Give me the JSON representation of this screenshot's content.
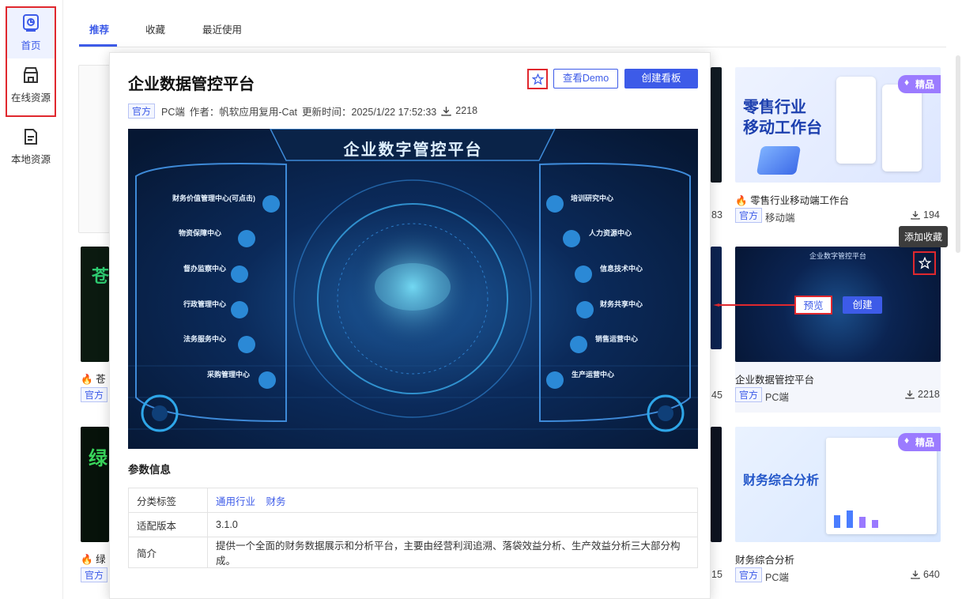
{
  "sidebar": {
    "items": [
      {
        "label": "首页",
        "icon": "home-icon"
      },
      {
        "label": "在线资源",
        "icon": "store-icon"
      },
      {
        "label": "本地资源",
        "icon": "document-icon"
      }
    ]
  },
  "tabs": [
    {
      "label": "推荐"
    },
    {
      "label": "收藏"
    },
    {
      "label": "最近使用"
    }
  ],
  "cards": {
    "retail": {
      "title": "零售行业移动端工作台",
      "tag": "官方",
      "platform": "移动端",
      "downloads": "194",
      "badge": "精品",
      "thumb_title": "零售行业\n移动工作台"
    },
    "enterprise": {
      "title": "企业数据管控平台",
      "tag": "官方",
      "platform": "PC端",
      "downloads": "2218"
    },
    "finance": {
      "title": "财务综合分析",
      "tag": "官方",
      "platform": "PC端",
      "downloads": "640",
      "badge": "精品",
      "thumb_title": "财务综合分析"
    },
    "left1": {
      "title": "苍",
      "tag": "官方",
      "thumb_text": "苍"
    },
    "left2": {
      "title": "绿",
      "tag": "官方",
      "thumb_text": "绿"
    },
    "partial_counts": [
      "83",
      "45",
      "15"
    ]
  },
  "hover": {
    "tooltip": "添加收藏",
    "preview_label": "预览",
    "create_label": "创建"
  },
  "modal": {
    "title": "企业数据管控平台",
    "demo_label": "查看Demo",
    "create_label": "创建看板",
    "tag": "官方",
    "platform": "PC端",
    "author": "作者：帆软应用复用-Cat",
    "updated": "更新时间：2025/1/22 17:52:33",
    "downloads": "2218",
    "hero_title": "企业数字管控平台",
    "section_title": "参数信息",
    "params": {
      "category_key": "分类标签",
      "category_values": [
        "通用行业",
        "财务"
      ],
      "version_key": "适配版本",
      "version_value": "3.1.0",
      "intro_key": "简介",
      "intro_value": "提供一个全面的财务数据展示和分析平台，主要由经营利润追溯、落袋效益分析、生产效益分析三大部分构成。"
    },
    "hero_left": [
      {
        "label": "财务价值管理中心(可点击)"
      },
      {
        "label": "物资保障中心"
      },
      {
        "label": "督办监察中心"
      },
      {
        "label": "行政管理中心"
      },
      {
        "label": "法务服务中心"
      },
      {
        "label": "采购管理中心"
      }
    ],
    "hero_right": [
      {
        "label": "培训研究中心"
      },
      {
        "label": "人力资源中心"
      },
      {
        "label": "信息技术中心"
      },
      {
        "label": "财务共享中心"
      },
      {
        "label": "销售运营中心"
      },
      {
        "label": "生产运营中心"
      }
    ]
  },
  "colors": {
    "accent": "#3d5be8",
    "annotation": "#e0282e",
    "premium": "#9b7bff"
  }
}
